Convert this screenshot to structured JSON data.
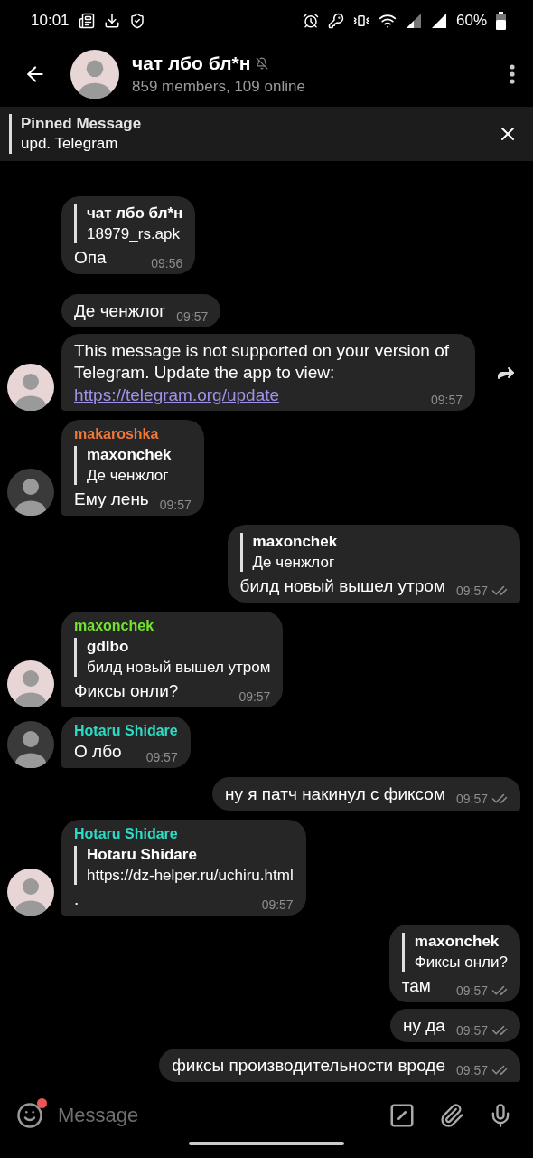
{
  "status_bar": {
    "time": "10:01",
    "battery": "60%"
  },
  "header": {
    "title": "чат лбо бл*н",
    "muted": true,
    "subtitle": "859 members, 109 online"
  },
  "pinned": {
    "title": "Pinned Message",
    "text": "upd. Telegram"
  },
  "messages": [
    {
      "kind": "in",
      "avatar": false,
      "tail": false,
      "reply": {
        "name": "чат лбо бл*н",
        "text": "18979_rs.apk"
      },
      "text": "Опа",
      "time": "09:56"
    },
    {
      "kind": "in",
      "avatar": false,
      "tail": false,
      "text": "Де ченжлог",
      "time": "09:57"
    },
    {
      "kind": "in",
      "avatar": true,
      "tail": true,
      "forward": true,
      "text": "This message is not supported on your version of Telegram. Update the app to view:",
      "link": "https://telegram.org/update",
      "time": "09:57"
    },
    {
      "kind": "in",
      "avatar": true,
      "tail": true,
      "sender": "makaroshka",
      "color": "#f0773a",
      "reply": {
        "name": "maxonchek",
        "text": "Де ченжлог"
      },
      "text": "Ему лень",
      "time": "09:57"
    },
    {
      "kind": "out",
      "tail": true,
      "reply": {
        "name": "maxonchek",
        "text": "Де ченжлог"
      },
      "text": "билд новый вышел утром",
      "time": "09:57",
      "read": true
    },
    {
      "kind": "in",
      "avatar": true,
      "tail": true,
      "sender": "maxonchek",
      "color": "#72e52c",
      "reply": {
        "name": "gdlbo",
        "text": "билд новый вышел утром"
      },
      "text": "Фиксы онли?",
      "time": "09:57"
    },
    {
      "kind": "in",
      "avatar": true,
      "tail": true,
      "sender": "Hotaru Shidare",
      "color": "#2ddcc4",
      "text": "О лбо",
      "time": "09:57"
    },
    {
      "kind": "out",
      "tail": true,
      "text": "ну я патч накинул с фиксом",
      "time": "09:57",
      "read": true
    },
    {
      "kind": "in",
      "avatar": true,
      "tail": true,
      "sender": "Hotaru Shidare",
      "color": "#2ddcc4",
      "reply": {
        "name": "Hotaru Shidare",
        "text": "https://dz-helper.ru/uchiru.html"
      },
      "text": ".",
      "time": "09:57"
    },
    {
      "kind": "out",
      "tail": false,
      "reply": {
        "name": "maxonchek",
        "text": "Фиксы онли?"
      },
      "text": "там",
      "time": "09:57",
      "read": true
    },
    {
      "kind": "out",
      "tail": false,
      "text": "ну да",
      "time": "09:57",
      "read": true
    },
    {
      "kind": "out",
      "tail": true,
      "text": "фиксы производительности вроде",
      "time": "09:57",
      "read": true
    }
  ],
  "composer": {
    "placeholder": "Message",
    "sticker_badge": true
  }
}
